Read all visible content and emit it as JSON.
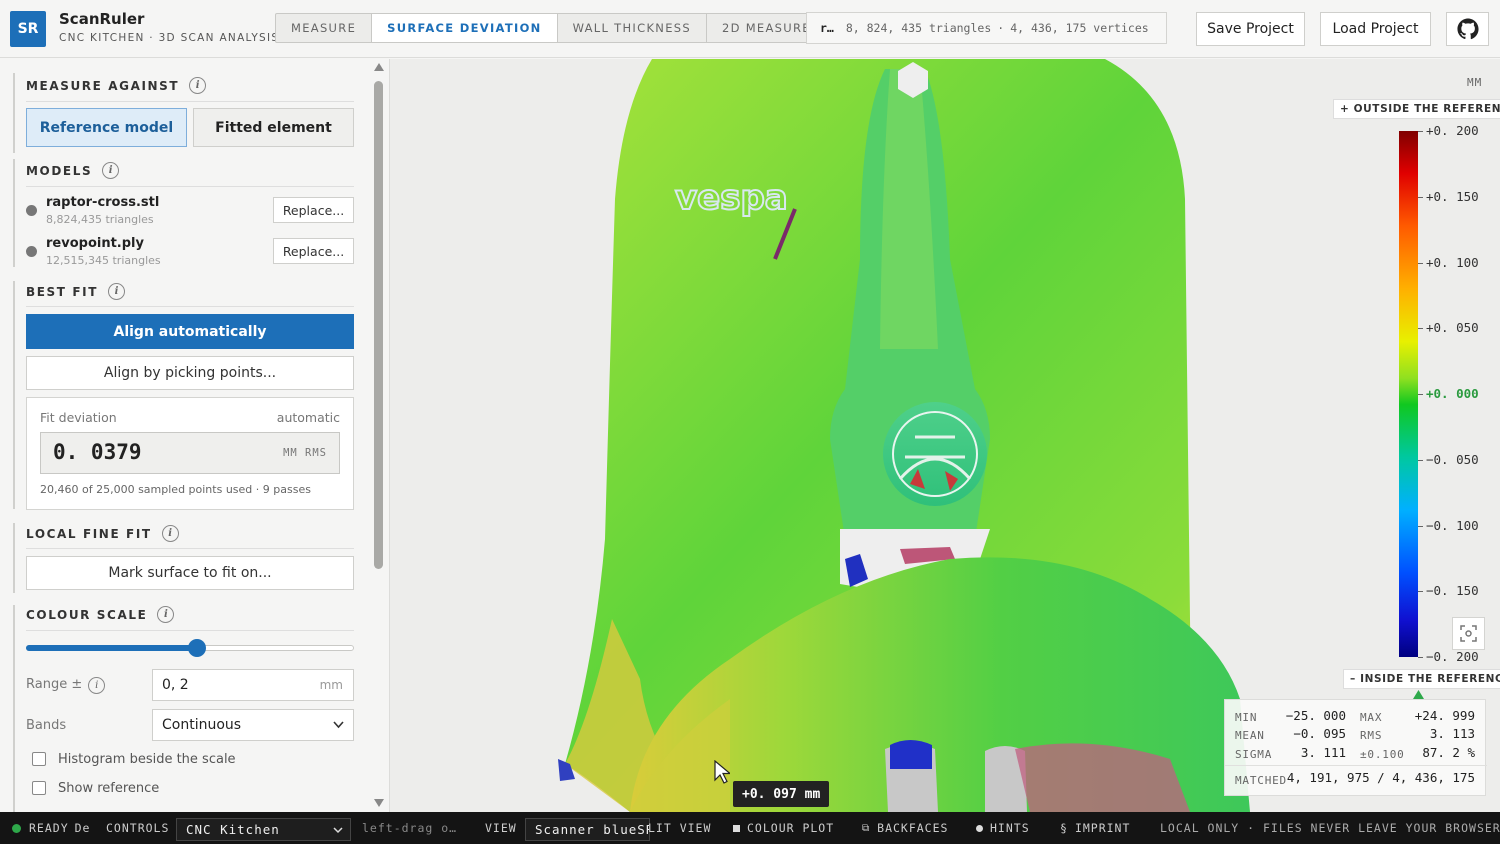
{
  "header": {
    "logo": "SR",
    "title": "ScanRuler",
    "subtitle": "CNC KITCHEN · 3D SCAN ANALYSIS",
    "tabs": [
      {
        "label": "MEASURE",
        "active": false
      },
      {
        "label": "SURFACE DEVIATION",
        "active": true
      },
      {
        "label": "WALL THICKNESS",
        "active": false
      },
      {
        "label": "2D MEASURE",
        "active": false
      }
    ],
    "scan_info": {
      "file": "r…",
      "triangles": "8, 824, 435 triangles",
      "sep": "·",
      "vertices": "4, 436, 175 vertices"
    },
    "save_label": "Save Project",
    "load_label": "Load Project",
    "github_icon": "github-icon"
  },
  "sidebar": {
    "measure_against": {
      "title": "MEASURE AGAINST",
      "options": [
        "Reference model",
        "Fitted element"
      ],
      "selected": "Reference model"
    },
    "models": {
      "title": "MODELS",
      "items": [
        {
          "name": "raptor-cross.stl",
          "sub": "8,824,435 triangles",
          "button": "Replace..."
        },
        {
          "name": "revopoint.ply",
          "sub": "12,515,345 triangles",
          "button": "Replace..."
        }
      ]
    },
    "best_fit": {
      "title": "BEST FIT",
      "align_auto": "Align automatically",
      "align_pick": "Align by picking points...",
      "fit_label": "Fit deviation",
      "fit_mode": "automatic",
      "fit_value": "0. 0379",
      "fit_unit": "MM RMS",
      "fit_note": "20,460 of 25,000 sampled points used · 9 passes"
    },
    "local_fine_fit": {
      "title": "LOCAL FINE FIT",
      "button": "Mark surface to fit on..."
    },
    "colour_scale": {
      "title": "COLOUR SCALE",
      "slider_fraction": 0.52,
      "range_label": "Range ±",
      "range_value": "0, 2",
      "range_unit": "mm",
      "bands_label": "Bands",
      "bands_value": "Continuous",
      "checks": [
        {
          "label": "Histogram beside the scale",
          "checked": false
        },
        {
          "label": "Show reference",
          "checked": false
        }
      ]
    }
  },
  "viewport": {
    "unit": "MM",
    "outside_tag": "+ OUTSIDE THE REFERENCE",
    "inside_tag": "– INSIDE THE REFERENCE",
    "ticks": [
      "+0. 200",
      "+0. 150",
      "+0. 100",
      "+0. 050",
      "+0. 000",
      "−0. 050",
      "−0. 100",
      "−0. 150",
      "−0. 200"
    ],
    "stats": {
      "min_k": "MIN",
      "min_v": "−25. 000",
      "max_k": "MAX",
      "max_v": "+24. 999",
      "mean_k": "MEAN",
      "mean_v": "−0. 095",
      "rms_k": "RMS",
      "rms_v": "3. 113",
      "sigma_k": "SIGMA",
      "sigma_v": "3. 111",
      "tol_k": "±0.100",
      "tol_v": "87. 2 %",
      "matched_k": "MATCHED",
      "matched_v": "4, 191, 975 / 4, 436, 175"
    },
    "tooltip": "+0. 097 mm",
    "brand_text": "vespa"
  },
  "statusbar": {
    "ready": "READY",
    "de": "De",
    "controls_label": "CONTROLS",
    "controls_value": "CNC Kitchen",
    "hint": "left-drag o…",
    "view_label": "VIEW",
    "view_value": "Scanner blueSR",
    "split_view": "LIT VIEW",
    "colour_plot": "COLOUR PLOT",
    "backfaces": "BACKFACES",
    "hints": "HINTS",
    "imprint": "IMPRINT",
    "local_only": "LOCAL ONLY · FILES NEVER LEAVE YOUR BROWSER",
    "colors": {
      "ready_dot": "#2ea84a",
      "accent": "#1d6fb8"
    }
  }
}
